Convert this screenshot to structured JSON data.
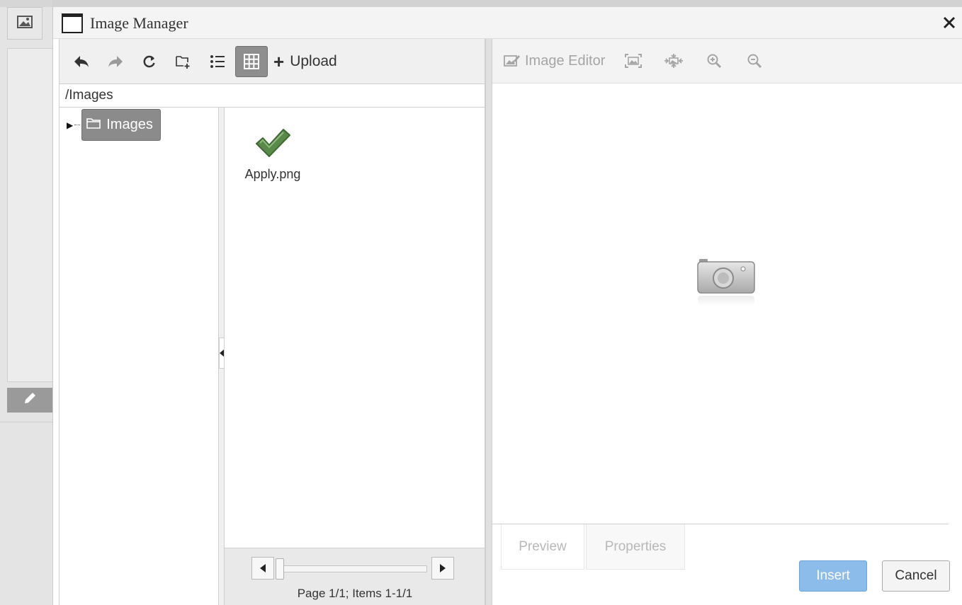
{
  "dialog": {
    "title": "Image Manager",
    "close_label": "✕"
  },
  "toolbar": {
    "back_icon": "back-arrow-icon",
    "forward_icon": "forward-arrow-icon",
    "refresh_icon": "refresh-icon",
    "new_folder_icon": "new-folder-icon",
    "list_view_icon": "list-view-icon",
    "thumbnail_view_icon": "thumbnail-view-icon",
    "upload_label": "Upload"
  },
  "path": "/Images",
  "tree": {
    "root_label": "Images"
  },
  "files": [
    {
      "name": "Apply.png",
      "icon": "checkmark-icon"
    }
  ],
  "pager": {
    "text": "Page 1/1; Items 1-1/1"
  },
  "right_toolbar": {
    "image_editor_label": "Image Editor"
  },
  "preview": {
    "placeholder_icon": "camera-icon"
  },
  "tabs": [
    {
      "label": "Preview"
    },
    {
      "label": "Properties"
    }
  ],
  "buttons": {
    "insert_label": "Insert",
    "cancel_label": "Cancel"
  },
  "colors": {
    "accent": "#8cbdea",
    "selected": "#8b8b8b",
    "check_green": "#5a8a4a"
  }
}
